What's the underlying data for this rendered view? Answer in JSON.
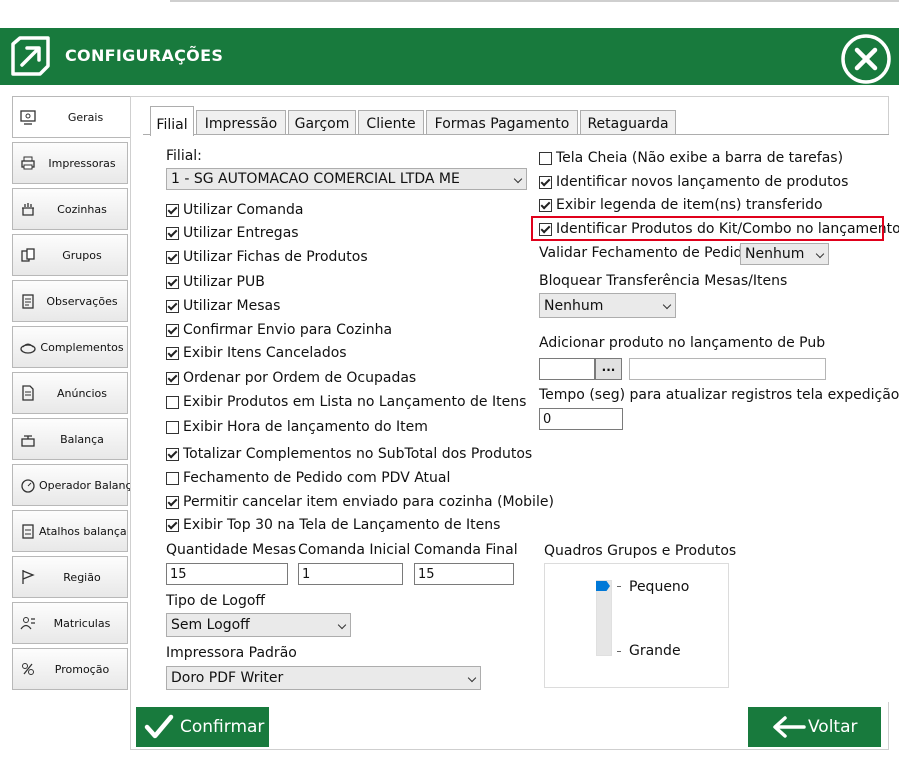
{
  "window": {
    "title": "CONFIGURAÇÕES"
  },
  "sidebar": {
    "items": [
      {
        "label": "Gerais",
        "icon": "settings-screen-icon",
        "active": true
      },
      {
        "label": "Impressoras",
        "icon": "printer-icon"
      },
      {
        "label": "Cozinhas",
        "icon": "kitchen-icon"
      },
      {
        "label": "Grupos",
        "icon": "group-icon"
      },
      {
        "label": "Observações",
        "icon": "clipboard-icon"
      },
      {
        "label": "Complementos",
        "icon": "complement-icon"
      },
      {
        "label": "Anúncios",
        "icon": "document-icon"
      },
      {
        "label": "Balança",
        "icon": "scale-icon"
      },
      {
        "label": "Operador Balança",
        "icon": "operator-scale-icon"
      },
      {
        "label": "Atalhos balança",
        "icon": "scale-shortcut-icon"
      },
      {
        "label": "Região",
        "icon": "flag-icon"
      },
      {
        "label": "Matriculas",
        "icon": "register-icon"
      },
      {
        "label": "Promoção",
        "icon": "promotion-icon"
      }
    ]
  },
  "tabs": [
    "Filial",
    "Impressão",
    "Garçom",
    "Cliente",
    "Formas Pagamento",
    "Retaguarda"
  ],
  "filial": {
    "label": "Filial:",
    "value": "1 - SG AUTOMACAO COMERCIAL LTDA ME"
  },
  "left_options": [
    {
      "label": "Utilizar Comanda",
      "checked": true
    },
    {
      "label": "Utilizar Entregas",
      "checked": true
    },
    {
      "label": "Utilizar Fichas de Produtos",
      "checked": true
    },
    {
      "label": "Utilizar PUB",
      "checked": true
    },
    {
      "label": "Utilizar Mesas",
      "checked": true
    },
    {
      "label": "Confirmar Envio para Cozinha",
      "checked": true
    },
    {
      "label": "Exibir Itens Cancelados",
      "checked": true
    },
    {
      "label": "Ordenar por Ordem de Ocupadas",
      "checked": true
    },
    {
      "label": "Exibir Produtos em Lista no Lançamento de Itens",
      "checked": false
    },
    {
      "label": "Exibir Hora de lançamento do Item",
      "checked": false
    },
    {
      "label": "Totalizar Complementos no SubTotal dos Produtos",
      "checked": true
    },
    {
      "label": "Fechamento de Pedido com PDV Atual",
      "checked": false
    },
    {
      "label": "Permitir cancelar item enviado para cozinha (Mobile)",
      "checked": true
    },
    {
      "label": "Exibir Top 30 na Tela de Lançamento de Itens",
      "checked": true
    }
  ],
  "right_options": [
    {
      "label": "Tela Cheia (Não exibe a barra de tarefas)",
      "checked": false
    },
    {
      "label": "Identificar novos lançamento de produtos",
      "checked": true
    },
    {
      "label": "Exibir legenda de item(ns) transferido",
      "checked": true
    },
    {
      "label": "Identificar Produtos do Kit/Combo no lançamento",
      "checked": true
    }
  ],
  "validar": {
    "label": "Validar Fechamento de Pedido",
    "value": "Nenhum"
  },
  "bloquear": {
    "label": "Bloquear Transferência Mesas/Itens",
    "value": "Nenhum"
  },
  "adicionar": {
    "label": "Adicionar produto no lançamento de Pub",
    "button": "...",
    "code": "",
    "description": ""
  },
  "tempo": {
    "label": "Tempo (seg) para atualizar registros tela expedição",
    "value": "0"
  },
  "quantidades": {
    "mesas_label": "Quantidade Mesas",
    "mesas_value": "15",
    "inicial_label": "Comanda Inicial",
    "inicial_value": "1",
    "final_label": "Comanda Final",
    "final_value": "15"
  },
  "logoff": {
    "label": "Tipo de Logoff",
    "value": "Sem Logoff"
  },
  "impressora": {
    "label": "Impressora Padrão",
    "value": "Doro PDF Writer"
  },
  "quadros": {
    "label": "Quadros Grupos e Produtos",
    "min_label": "Pequeno",
    "max_label": "Grande",
    "level": 0
  },
  "footer": {
    "confirm": "Confirmar",
    "back": "Voltar"
  },
  "colors": {
    "header": "#187a3d",
    "highlight": "#e0001b",
    "slider": "#0078d7"
  }
}
